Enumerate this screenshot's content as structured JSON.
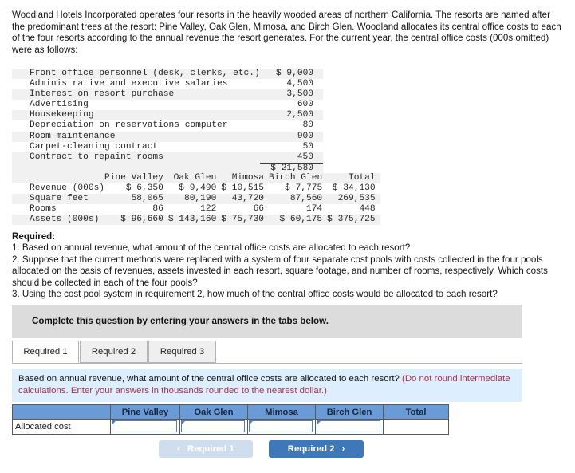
{
  "intro": "Woodland Hotels Incorporated operates four resorts in the heavily wooded areas of northern California. The resorts are named after the predominant trees at the resort: Pine Valley, Oak Glen, Mimosa, and Birch Glen. Woodland allocates its central office costs to each of the four resorts according to the annual revenue the resort generates. For the current year, the central office costs (000s omitted) were as follows:",
  "cost_table": {
    "rows": [
      {
        "label": "Front office personnel (desk, clerks, etc.)",
        "amount": "$ 9,000"
      },
      {
        "label": "Administrative and executive salaries",
        "amount": "4,500"
      },
      {
        "label": "Interest on resort purchase",
        "amount": "3,500"
      },
      {
        "label": "Advertising",
        "amount": "600"
      },
      {
        "label": "Housekeeping",
        "amount": "2,500"
      },
      {
        "label": "Depreciation on reservations computer",
        "amount": "80"
      },
      {
        "label": "Room maintenance",
        "amount": "900"
      },
      {
        "label": "Carpet-cleaning contract",
        "amount": "50"
      },
      {
        "label": "Contract to repaint rooms",
        "amount": "450"
      }
    ],
    "total": "$ 21,580"
  },
  "resort_table": {
    "headers": [
      "",
      "Pine Valley",
      "Oak Glen",
      "Mimosa",
      "Birch Glen",
      "Total"
    ],
    "rows": [
      {
        "label": "Revenue (000s)",
        "values": [
          "$ 6,350",
          "$ 9,490",
          "$ 10,515",
          "$ 7,775",
          "$ 34,130"
        ]
      },
      {
        "label": "Square feet",
        "values": [
          "58,065",
          "80,190",
          "43,720",
          "87,560",
          "269,535"
        ]
      },
      {
        "label": "Rooms",
        "values": [
          "86",
          "122",
          "66",
          "174",
          "448"
        ]
      },
      {
        "label": "Assets (000s)",
        "values": [
          "$ 96,660",
          "$ 143,160",
          "$ 75,730",
          "$ 60,175",
          "$ 375,725"
        ]
      }
    ]
  },
  "required": {
    "heading": "Required:",
    "items": [
      "1. Based on annual revenue, what amount of the central office costs are allocated to each resort?",
      "2. Suppose that the current methods were replaced with a system of four separate cost pools with costs collected in the four pools allocated on the basis of revenues, assets invested in each resort, square footage, and number of rooms, respectively. Which costs should be collected in each of the four pools?",
      "3. Using the cost pool system in requirement 2, how much of the central office costs would be allocated to each resort?"
    ]
  },
  "banner": {
    "text": "Complete this question by entering your answers in the tabs below."
  },
  "tabs": [
    {
      "label": "Required 1",
      "active": true
    },
    {
      "label": "Required 2",
      "active": false
    },
    {
      "label": "Required 3",
      "active": false
    }
  ],
  "instruction": {
    "black": "Based on annual revenue, what amount of the central office costs are allocated to each resort? ",
    "red": "(Do not round intermediate calculations. Enter your answers in thousands rounded to the nearest dollar.)"
  },
  "answer_table": {
    "headers": [
      "",
      "Pine Valley",
      "Oak Glen",
      "Mimosa",
      "Birch Glen",
      "Total"
    ],
    "row_label": "Allocated cost",
    "values": [
      "",
      "",
      "",
      ""
    ],
    "total_value": ""
  },
  "nav": {
    "prev_label": "Required 1",
    "prev_chevron": "‹",
    "next_label": "Required 2",
    "next_chevron": "›"
  },
  "colors": {
    "accent_blue": "#3f78b8",
    "header_blue": "#6b9bd6",
    "panel_blue": "#ddeeff",
    "banner_gray": "#dcdcdc",
    "red_text": "#a8324a"
  }
}
